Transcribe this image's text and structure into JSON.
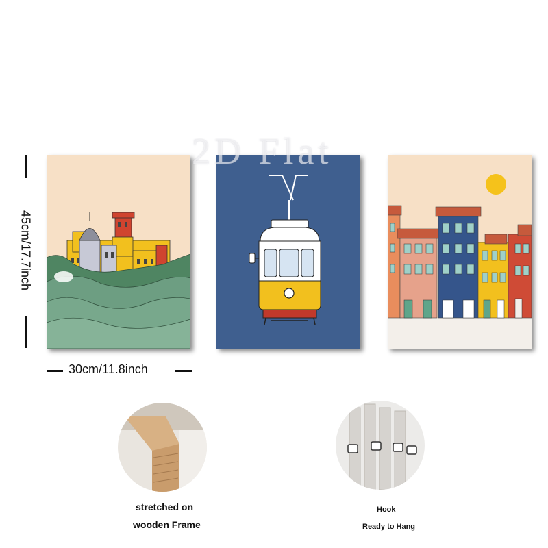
{
  "watermark": "2D Flat",
  "dimensions": {
    "height_label": "45cm/17.7inch",
    "width_label": "30cm/11.8inch"
  },
  "panels": [
    {
      "subject": "castle-on-green-hills",
      "background": "#f7e0c6"
    },
    {
      "subject": "yellow-tram",
      "background": "#3f5f8f"
    },
    {
      "subject": "colorful-row-houses",
      "background": "#f7e0c6"
    }
  ],
  "features": {
    "frame_line1": "stretched on",
    "frame_line2": "wooden Frame",
    "hook_line1": "Hook",
    "hook_line2": "Ready to Hang"
  },
  "colors": {
    "yellow": "#f2c01e",
    "green": "#6d9e82",
    "blue_panel": "#3f5f8f",
    "sun": "#f5c21b"
  }
}
